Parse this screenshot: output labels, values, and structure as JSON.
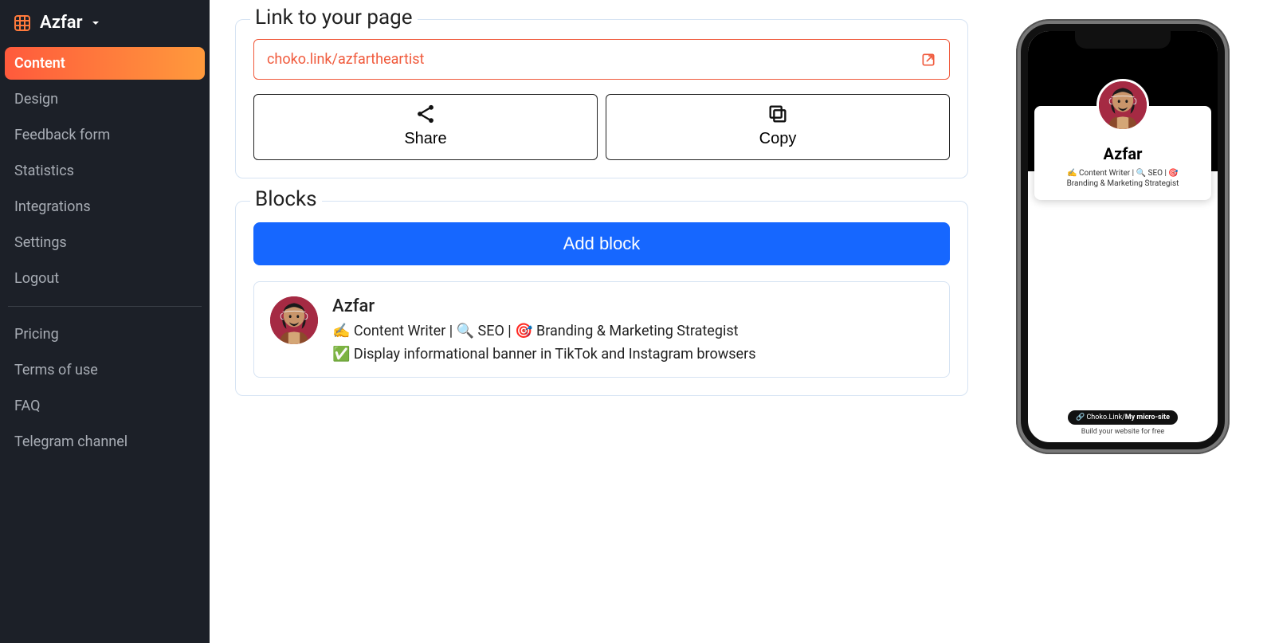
{
  "brand": {
    "name": "Azfar"
  },
  "sidebar": {
    "primary": [
      {
        "label": "Content",
        "active": true
      },
      {
        "label": "Design",
        "active": false
      },
      {
        "label": "Feedback form",
        "active": false
      },
      {
        "label": "Statistics",
        "active": false
      },
      {
        "label": "Integrations",
        "active": false
      },
      {
        "label": "Settings",
        "active": false
      },
      {
        "label": "Logout",
        "active": false
      }
    ],
    "secondary": [
      {
        "label": "Pricing"
      },
      {
        "label": "Terms of use"
      },
      {
        "label": "FAQ"
      },
      {
        "label": "Telegram channel"
      }
    ]
  },
  "link_panel": {
    "title": "Link to your page",
    "url": "choko.link/azfartheartist",
    "share_label": "Share",
    "copy_label": "Copy"
  },
  "blocks_panel": {
    "title": "Blocks",
    "add_label": "Add block",
    "profile": {
      "name": "Azfar",
      "bio": "✍️ Content Writer | 🔍 SEO | 🎯 Branding & Marketing Strategist",
      "info": "✅ Display informational banner in TikTok and Instagram browsers"
    }
  },
  "preview": {
    "name": "Azfar",
    "bio_line1": "✍️ Content Writer | 🔍 SEO | 🎯",
    "bio_line2": "Branding & Marketing Strategist",
    "badge_prefix": "🔗 Choko.Link/",
    "badge_bold": "My micro-site",
    "tagline": "Build your website for free"
  }
}
